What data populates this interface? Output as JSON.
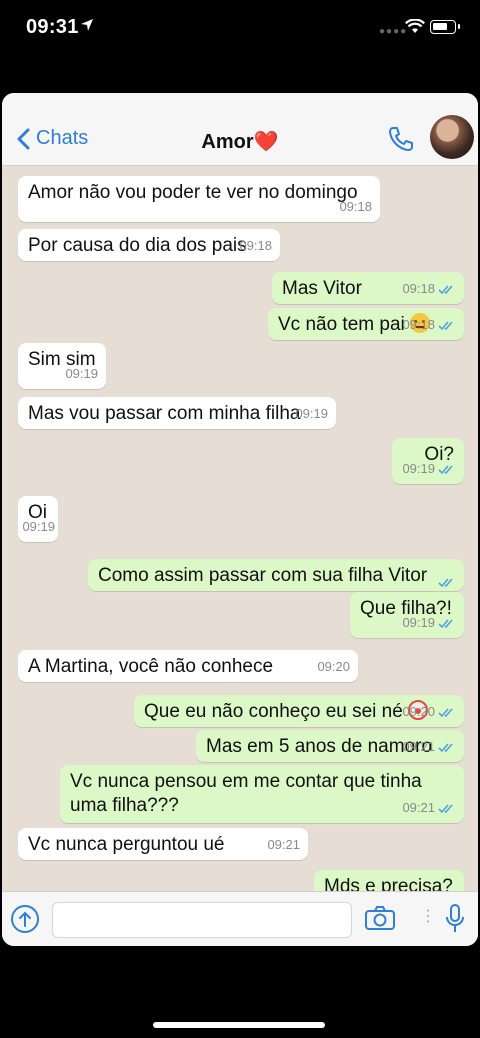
{
  "status_bar": {
    "time": "09:31"
  },
  "nav": {
    "back_label": "Chats",
    "title": "Amor❤️"
  },
  "messages": [
    {
      "dir": "in",
      "text": "Amor não vou poder te ver no domingo",
      "time": "09:18"
    },
    {
      "dir": "in",
      "text": "Por causa do dia dos pais",
      "time": "09:18"
    },
    {
      "dir": "out",
      "text": "Mas Vitor",
      "time": "09:18",
      "ticks": "read"
    },
    {
      "dir": "out",
      "text": "Vc não tem pai",
      "time": "09:18",
      "ticks": "read",
      "emoji": "face-with-raised-eyebrow"
    },
    {
      "dir": "in",
      "text": "Sim sim",
      "time": "09:19"
    },
    {
      "dir": "in",
      "text": "Mas vou passar com minha filha",
      "time": "09:19"
    },
    {
      "dir": "out",
      "text": "Oi?",
      "time": "09:19",
      "ticks": "read"
    },
    {
      "dir": "in",
      "text": "Oi",
      "time": "09:19"
    },
    {
      "dir": "out",
      "text": "Como assim passar com sua filha Vitor",
      "time": "09:19",
      "ticks": "read"
    },
    {
      "dir": "out",
      "text": "Que filha?!",
      "time": "09:19",
      "ticks": "read"
    },
    {
      "dir": "in",
      "text": "A Martina, você não conhece",
      "time": "09:20"
    },
    {
      "dir": "out",
      "text": "Que eu não conheço eu sei né",
      "time": "09:20",
      "ticks": "read",
      "emoji": "clown-face"
    },
    {
      "dir": "out",
      "text": "Mas em 5 anos de namoro",
      "time": "09:21",
      "ticks": "read"
    },
    {
      "dir": "out",
      "text": "Vc nunca pensou em me contar que tinha uma filha???",
      "time": "09:21",
      "ticks": "read"
    },
    {
      "dir": "in",
      "text": "Vc nunca perguntou ué",
      "time": "09:21"
    },
    {
      "dir": "out",
      "text": "Mds e precisa?",
      "time": "",
      "ticks": ""
    }
  ],
  "composer": {
    "input_value": "",
    "icons": [
      "plus-icon",
      "camera-icon",
      "microphone-icon"
    ]
  },
  "colors": {
    "accent": "#2f7fd8",
    "incoming": "#ffffff",
    "outgoing": "#dcf8c6",
    "chat_bg": "#e6ddd4",
    "read_ticks": "#4fa3e0"
  }
}
